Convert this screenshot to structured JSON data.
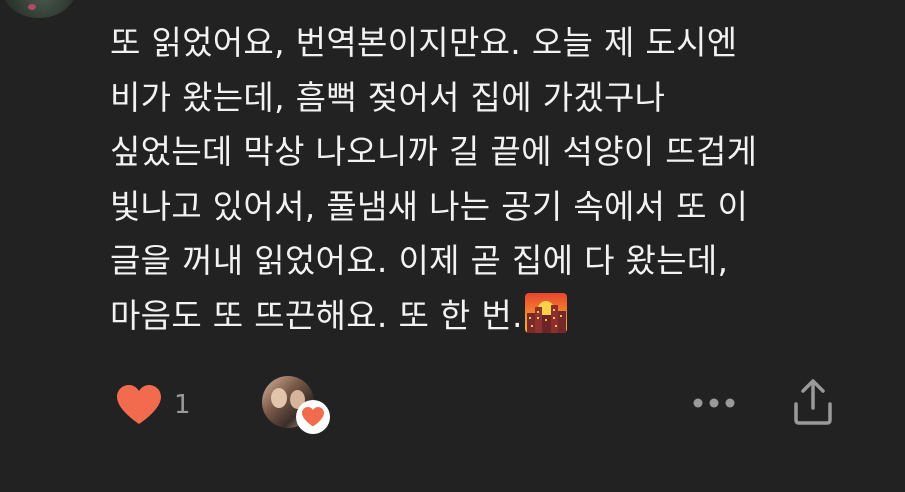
{
  "comment": {
    "lines": [
      "또 읽었어요, 번역본이지만요. 오늘 제 도시엔",
      "비가 왔는데, 흠뻑 젖어서 집에 가겠구나",
      "싶었는데 막상 나오니까 길 끝에 석양이 뜨겁게",
      "빛나고 있어서, 풀냄새 나는 공기 속에서 또 이",
      "글을 꺼내 읽었어요. 이제 곧 집에 다 왔는데,",
      "마음도 또 뜨끈해요. 또 한 번."
    ],
    "emoji": "sunset-city-emoji"
  },
  "actions": {
    "like_count": "1",
    "like_icon": "heart-icon",
    "more_icon": "more-dots-icon",
    "share_icon": "share-icon"
  },
  "colors": {
    "background": "#222222",
    "text": "#f2f2f2",
    "muted": "#9a9a9a",
    "heart": "#f26b4f",
    "icon": "#9a9a9a"
  }
}
